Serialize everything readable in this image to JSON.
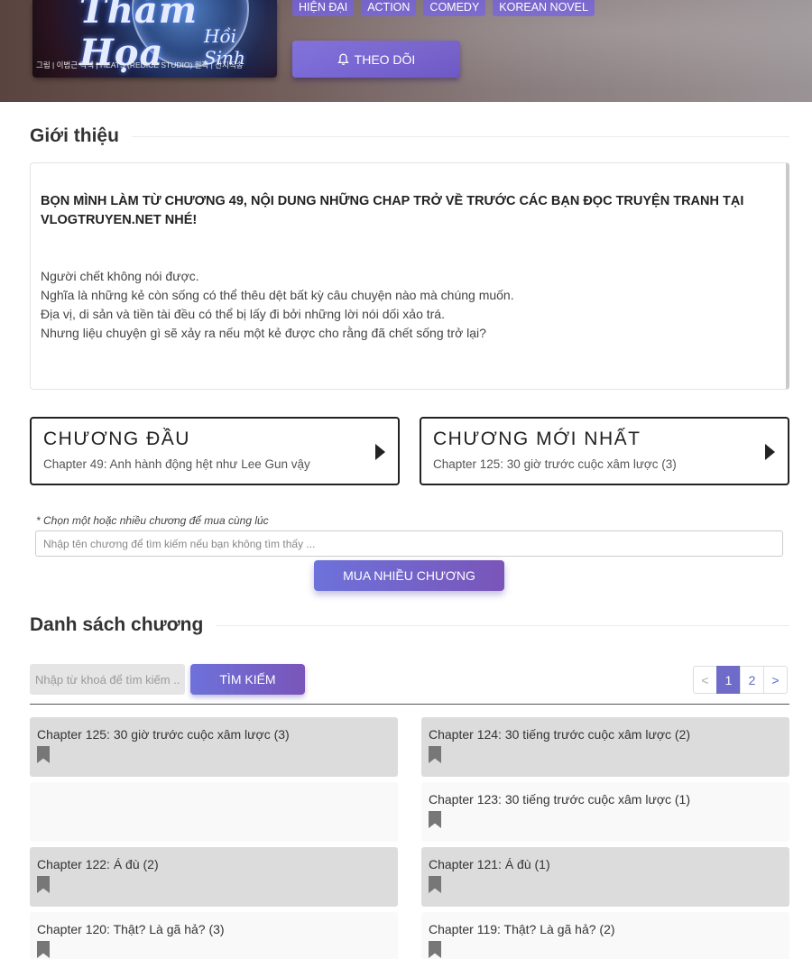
{
  "hero": {
    "cover": {
      "title_line1": "Thảm Họa",
      "title_line2": "Hồi Sinh",
      "credits": "그림 | 이범근    각색 | HEATS (REDICE STUDIO)    원작 | 산지직송"
    },
    "tags": [
      "Hiện đại",
      "Action",
      "Comedy",
      "Korean Novel"
    ],
    "follow_label": "THEO DÕI",
    "follow_icon": "bell-icon"
  },
  "intro": {
    "heading": "Giới thiệu",
    "note": "BỌN MÌNH LÀM TỪ CHƯƠNG 49, NỘI DUNG NHỮNG CHAP TRỞ VỀ TRƯỚC CÁC BẠN ĐỌC TRUYỆN TRANH TẠI VLOGTRUYEN.NET NHÉ!",
    "lines": [
      "Người chết không nói được.",
      "Nghĩa là những kẻ còn sống có thể thêu dệt bất kỳ câu chuyện nào mà chúng muốn.",
      "Địa vị, di sản và tiền tài đều có thể bị lấy đi bởi những lời nói dối xảo trá.",
      "Nhưng liệu chuyện gì sẽ xảy ra nếu một kẻ được cho rằng đã chết sống trở lại?"
    ]
  },
  "first_chapter": {
    "label": "CHƯƠNG ĐẦU",
    "sub": "Chapter 49: Anh hành động hệt như Lee Gun vậy"
  },
  "latest_chapter": {
    "label": "CHƯƠNG MỚI NHẤT",
    "sub": "Chapter 125: 30 giờ trước cuộc xâm lược (3)"
  },
  "buy": {
    "hint": "* Chọn một hoặc nhiều chương để mua cùng lúc",
    "placeholder": "Nhập tên chương để tìm kiếm nếu bạn không tìm thấy ...",
    "button": "MUA NHIỀU CHƯƠNG"
  },
  "chapter_list": {
    "heading": "Danh sách chương",
    "search_placeholder": "Nhập từ khoá để tìm kiếm ...",
    "search_button": "TÌM KIẾM",
    "pagination": {
      "prev": "<",
      "pages": [
        "1",
        "2"
      ],
      "current": "1",
      "next": ">"
    },
    "items": [
      {
        "title": "Chapter 125: 30 giờ trước cuộc xâm lược (3)",
        "shade": true
      },
      {
        "title": "Chapter 124: 30 tiếng trước cuộc xâm lược (2)",
        "shade": true
      },
      {
        "title": "",
        "shade": false
      },
      {
        "title": "Chapter 123: 30 tiếng trước cuộc xâm lược (1)",
        "shade": false
      },
      {
        "title": "Chapter 122: Á đù (2)",
        "shade": true
      },
      {
        "title": "Chapter 121: Á đù (1)",
        "shade": true
      },
      {
        "title": "Chapter 120: Thật? Là gã hả? (3)",
        "shade": false
      },
      {
        "title": "Chapter 119: Thật? Là gã hả? (2)",
        "shade": false
      }
    ]
  },
  "colors": {
    "accent": "#6f5cc8",
    "button_gradient_start": "#6d72da",
    "button_gradient_end": "#7a55b9",
    "row_shaded": "#dcdcdc",
    "row_light": "#f9f9f9"
  }
}
